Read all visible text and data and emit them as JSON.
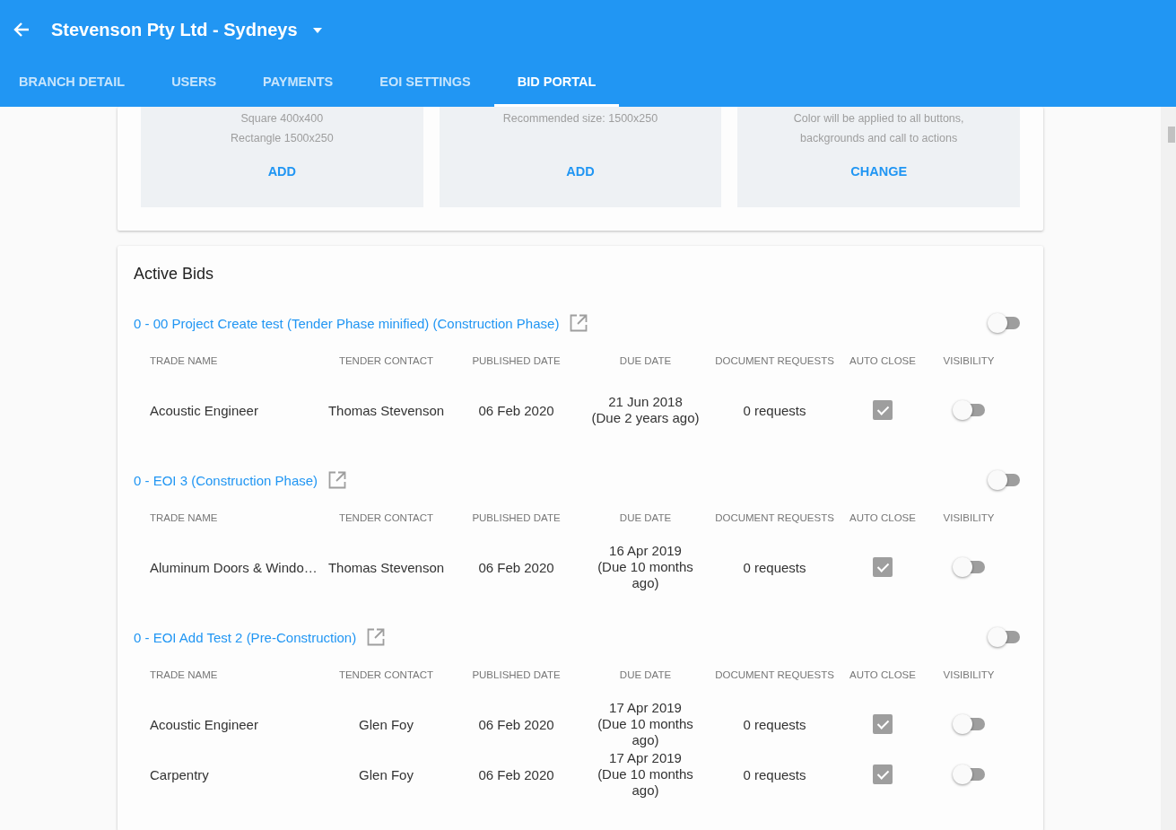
{
  "app_bar": {
    "title": "Stevenson Pty Ltd - Sydneys"
  },
  "tabs": [
    {
      "label": "BRANCH DETAIL",
      "selected": false
    },
    {
      "label": "USERS",
      "selected": false
    },
    {
      "label": "PAYMENTS",
      "selected": false
    },
    {
      "label": "EOI SETTINGS",
      "selected": false
    },
    {
      "label": "BID PORTAL",
      "selected": true
    }
  ],
  "upload_cards": [
    {
      "lines": [
        "Square 400x400",
        "Rectangle 1500x250"
      ],
      "action": "ADD"
    },
    {
      "lines": [
        "Recommended size: 1500x250"
      ],
      "action": "ADD"
    },
    {
      "lines": [
        "Color will be applied to all buttons,",
        "backgrounds and call to actions"
      ],
      "action": "CHANGE"
    }
  ],
  "active_bids": {
    "title": "Active Bids",
    "bids": [
      {
        "name": "0 - 00 Project Create test (Tender Phase minified) (Construction Phase)",
        "on": false,
        "columns": [
          "TRADE NAME",
          "TENDER CONTACT",
          "PUBLISHED DATE",
          "DUE DATE",
          "DOCUMENT REQUESTS",
          "AUTO CLOSE",
          "VISIBILITY"
        ],
        "rows": [
          {
            "trade": "Acoustic Engineer",
            "contact": "Thomas Stevenson",
            "published": "06 Feb 2020",
            "due": "21 Jun 2018",
            "due_note": "(Due 2 years ago)",
            "requests": "0 requests",
            "auto_close": true,
            "visible": false
          }
        ]
      },
      {
        "name": "0 - EOI 3 (Construction Phase)",
        "on": false,
        "columns": [
          "TRADE NAME",
          "TENDER CONTACT",
          "PUBLISHED DATE",
          "DUE DATE",
          "DOCUMENT REQUESTS",
          "AUTO CLOSE",
          "VISIBILITY"
        ],
        "rows": [
          {
            "trade": "Aluminum Doors & Windo…",
            "contact": "Thomas Stevenson",
            "published": "06 Feb 2020",
            "due": "16 Apr 2019",
            "due_note": "(Due 10 months ago)",
            "requests": "0 requests",
            "auto_close": true,
            "visible": false
          }
        ]
      },
      {
        "name": "0 - EOI Add Test 2 (Pre-Construction)",
        "on": false,
        "columns": [
          "TRADE NAME",
          "TENDER CONTACT",
          "PUBLISHED DATE",
          "DUE DATE",
          "DOCUMENT REQUESTS",
          "AUTO CLOSE",
          "VISIBILITY"
        ],
        "rows": [
          {
            "trade": "Acoustic Engineer",
            "contact": "Glen Foy",
            "published": "06 Feb 2020",
            "due": "17 Apr 2019",
            "due_note": "(Due 10 months ago)",
            "requests": "0 requests",
            "auto_close": true,
            "visible": false
          },
          {
            "trade": "Carpentry",
            "contact": "Glen Foy",
            "published": "06 Feb 2020",
            "due": "17 Apr 2019",
            "due_note": "(Due 10 months ago)",
            "requests": "0 requests",
            "auto_close": true,
            "visible": false
          }
        ]
      }
    ]
  }
}
